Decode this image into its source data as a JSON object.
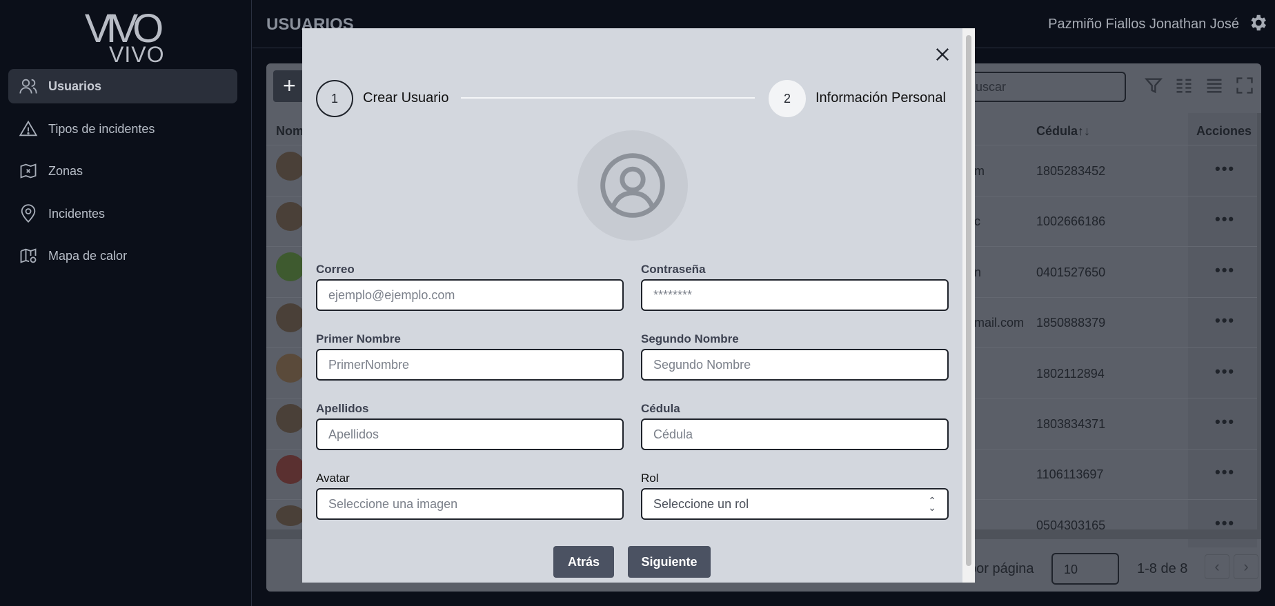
{
  "app": {
    "logo_line1": "VIVO",
    "logo_line2": "VIVO"
  },
  "sidebar": {
    "items": [
      {
        "label": "Usuarios",
        "icon": "users-icon",
        "active": true
      },
      {
        "label": "Tipos de incidentes",
        "icon": "warning-icon",
        "active": false
      },
      {
        "label": "Zonas",
        "icon": "zone-map-icon",
        "active": false
      },
      {
        "label": "Incidentes",
        "icon": "location-pin-icon",
        "active": false
      },
      {
        "label": "Mapa de calor",
        "icon": "heat-map-icon",
        "active": false
      }
    ]
  },
  "header": {
    "title": "USUARIOS",
    "user_name": "Pazmiño Fiallos Jonathan José"
  },
  "table": {
    "add_label": "+",
    "search_placeholder": "Buscar",
    "columns": {
      "name": "Nom",
      "cedula": "Cédula",
      "sort_icon": "↑↓",
      "actions": "Acciones"
    },
    "rows": [
      {
        "email_tail": "m",
        "cedula": "1805283452"
      },
      {
        "email_tail": "c",
        "cedula": "1002666186"
      },
      {
        "email_tail": "n",
        "cedula": "0401527650"
      },
      {
        "email_tail": "mail.com",
        "cedula": "1850888379"
      },
      {
        "email_tail": "",
        "cedula": "1802112894"
      },
      {
        "email_tail": "",
        "cedula": "1803834371"
      },
      {
        "email_tail": "",
        "cedula": "1106113697"
      },
      {
        "email_tail": "",
        "cedula": "0504303165"
      }
    ],
    "actions_glyph": "•••",
    "rows_per_page_label": "por página",
    "rows_per_page": "10",
    "range": "1-8 de 8"
  },
  "modal": {
    "steps": [
      {
        "number": "1",
        "label": "Crear Usuario"
      },
      {
        "number": "2",
        "label": "Información Personal"
      }
    ],
    "fields": {
      "correo": {
        "label": "Correo",
        "placeholder": "ejemplo@ejemplo.com"
      },
      "contrasena": {
        "label": "Contraseña",
        "placeholder": "********"
      },
      "primer_nombre": {
        "label": "Primer Nombre",
        "placeholder": "PrimerNombre"
      },
      "segundo_nombre": {
        "label": "Segundo Nombre",
        "placeholder": "Segundo Nombre"
      },
      "apellidos": {
        "label": "Apellidos",
        "placeholder": "Apellidos"
      },
      "cedula": {
        "label": "Cédula",
        "placeholder": "Cédula"
      },
      "avatar": {
        "label": "Avatar",
        "placeholder": "Seleccione una imagen"
      },
      "rol": {
        "label": "Rol",
        "value": "Seleccione un rol"
      }
    },
    "back_label": "Atrás",
    "next_label": "Siguiente"
  }
}
